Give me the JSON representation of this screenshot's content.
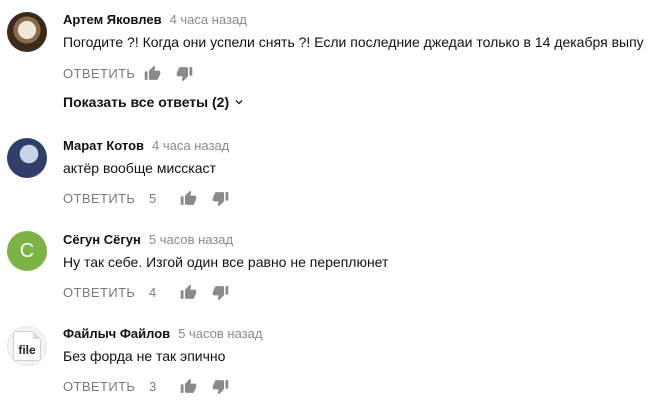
{
  "comments": [
    {
      "author": "Артем Яковлев",
      "time": "4 часа назад",
      "text": "Погодите  ?! Когда они успели снять ?! Если последние джедаи только в 14 декабря выпу",
      "reply_label": "ОТВЕТИТЬ",
      "likes": "",
      "avatar": "clown-avatar",
      "show_replies": "Показать все ответы (2)"
    },
    {
      "author": "Марат Котов",
      "time": "4 часа назад",
      "text": "актёр вообще мисскаст",
      "reply_label": "ОТВЕТИТЬ",
      "likes": "5",
      "avatar": "photo-avatar"
    },
    {
      "author": "Сёгун Сёгун",
      "time": "5 часов назад",
      "text": "Ну так себе. Изгой один все равно не переплюнет",
      "reply_label": "ОТВЕТИТЬ",
      "likes": "4",
      "avatar_letter": "С",
      "avatar_color": "#7cb342"
    },
    {
      "author": "Файлыч Файлов",
      "time": "5 часов назад",
      "text": "Без форда не так эпично",
      "reply_label": "ОТВЕТИТЬ",
      "likes": "3",
      "avatar_text": "file"
    }
  ],
  "colors": {
    "meta_gray": "#8a8a8a",
    "text": "#111111",
    "avatar_green": "#7cb342"
  },
  "icons": [
    "thumb-up-icon",
    "thumb-down-icon",
    "chevron-down-icon"
  ]
}
